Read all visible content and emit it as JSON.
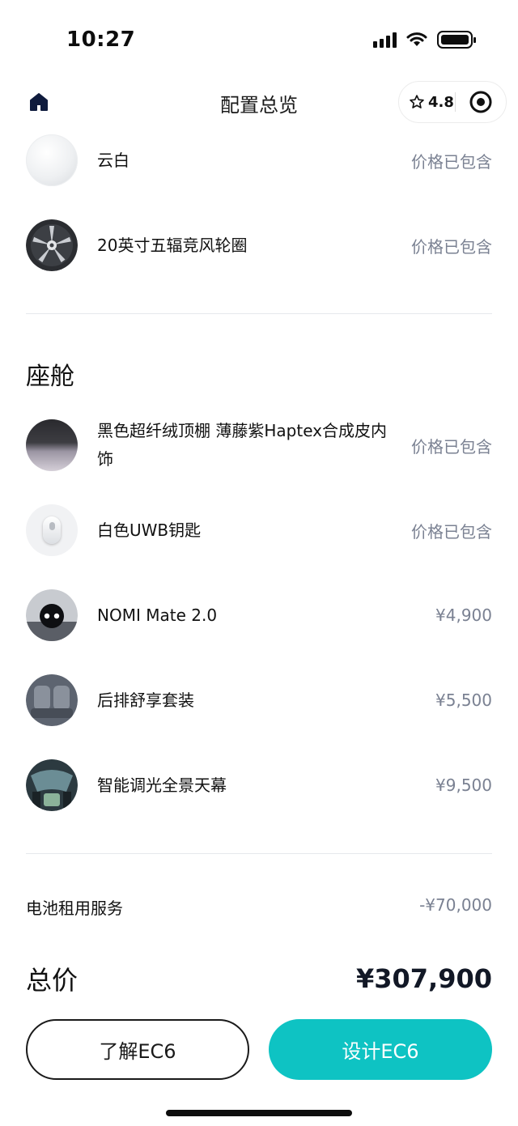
{
  "status_bar": {
    "time": "10:27"
  },
  "nav": {
    "title": "配置总览",
    "rating": "4.8"
  },
  "exterior_items": [
    {
      "label": "云白",
      "price": "价格已包含",
      "thumb": "white-paint-swatch"
    },
    {
      "label": "20英寸五辐竞风轮圈",
      "price": "价格已包含",
      "thumb": "wheel-rim"
    }
  ],
  "cabin": {
    "title": "座舱",
    "items": [
      {
        "label": "黑色超纤绒顶棚 薄藤紫Haptex合成皮内饰",
        "price": "价格已包含",
        "thumb": "interior-headliner"
      },
      {
        "label": "白色UWB钥匙",
        "price": "价格已包含",
        "thumb": "uwb-key"
      },
      {
        "label": "NOMI Mate 2.0",
        "price": "¥4,900",
        "thumb": "nomi-robot"
      },
      {
        "label": "后排舒享套装",
        "price": "¥5,500",
        "thumb": "rear-seats"
      },
      {
        "label": "智能调光全景天幕",
        "price": "¥9,500",
        "thumb": "panoramic-roof"
      }
    ]
  },
  "battery_service": {
    "label": "电池租用服务",
    "value": "-¥70,000"
  },
  "total": {
    "label": "总价",
    "value": "¥307,900"
  },
  "buttons": {
    "learn": "了解EC6",
    "design": "设计EC6"
  },
  "colors": {
    "accent": "#0ec3c3",
    "price_gray": "#7a8192",
    "text": "#121826"
  }
}
